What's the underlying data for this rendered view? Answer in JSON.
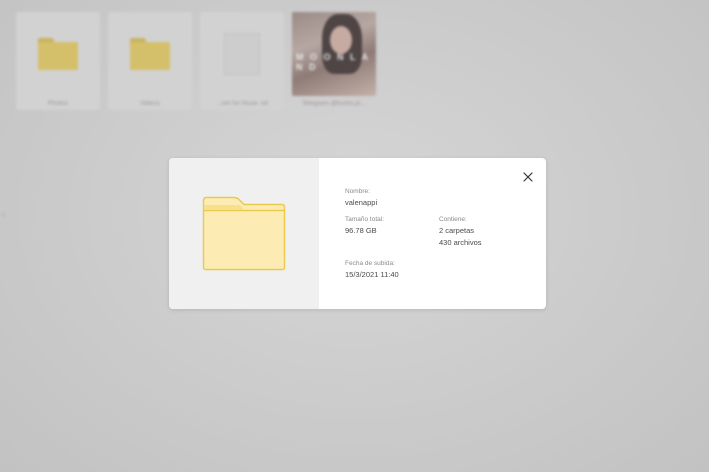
{
  "background": {
    "tiles": [
      {
        "caption": "Photos",
        "kind": "folder"
      },
      {
        "caption": "Videos",
        "kind": "folder"
      },
      {
        "caption": "...ore for those .txt",
        "kind": "document"
      },
      {
        "caption": "Telegram @hortiz.pr...",
        "kind": "photo",
        "watermark": "M O O N L A N D"
      }
    ]
  },
  "modal": {
    "close_icon": "close-icon",
    "preview_icon": "folder-icon",
    "name_label": "Nombre:",
    "name_value": "valenappi",
    "size_label": "Tamaño total:",
    "size_value": "96.78 GB",
    "contains_label": "Contiene:",
    "contains_folders": "2 carpetas",
    "contains_files": "430 archivos",
    "upload_label": "Fecha de subida:",
    "upload_value": "15/3/2021 11:40"
  },
  "colors": {
    "folder_fill": "#fcecb4",
    "folder_stroke": "#e9c94e",
    "overlay": "#cbcbcb"
  }
}
